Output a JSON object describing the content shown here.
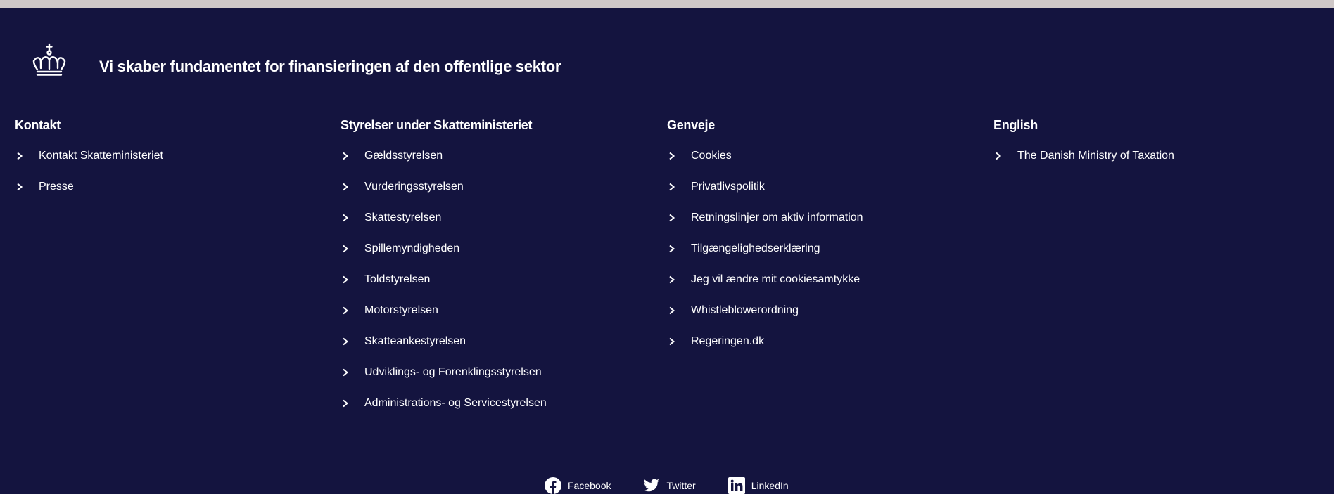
{
  "brand": {
    "logo_icon": "royal-crown-icon",
    "tagline": "Vi skaber fundamentet for finansieringen af den offentlige sektor"
  },
  "columns": [
    {
      "heading": "Kontakt",
      "links": [
        "Kontakt Skatteministeriet",
        "Presse"
      ]
    },
    {
      "heading": "Styrelser under Skatteministeriet",
      "links": [
        "Gældsstyrelsen",
        "Vurderingsstyrelsen",
        "Skattestyrelsen",
        "Spillemyndigheden",
        "Toldstyrelsen",
        "Motorstyrelsen",
        "Skatteankestyrelsen",
        "Udviklings- og Forenklingsstyrelsen",
        "Administrations- og Servicestyrelsen"
      ]
    },
    {
      "heading": "Genveje",
      "links": [
        "Cookies",
        "Privatlivspolitik",
        "Retningslinjer om aktiv information",
        "Tilgængelighedserklæring",
        "Jeg vil ændre mit cookiesamtykke",
        "Whistleblowerordning",
        "Regeringen.dk"
      ]
    },
    {
      "heading": "English",
      "links": [
        "The Danish Ministry of Taxation"
      ]
    }
  ],
  "social": [
    {
      "label": "Facebook",
      "icon": "facebook-icon"
    },
    {
      "label": "Twitter",
      "icon": "twitter-icon"
    },
    {
      "label": "LinkedIn",
      "icon": "linkedin-icon"
    }
  ],
  "colors": {
    "background": "#14143f",
    "top_strip": "#cfc8c8",
    "text": "#ffffff",
    "divider": "#3a3a63"
  }
}
